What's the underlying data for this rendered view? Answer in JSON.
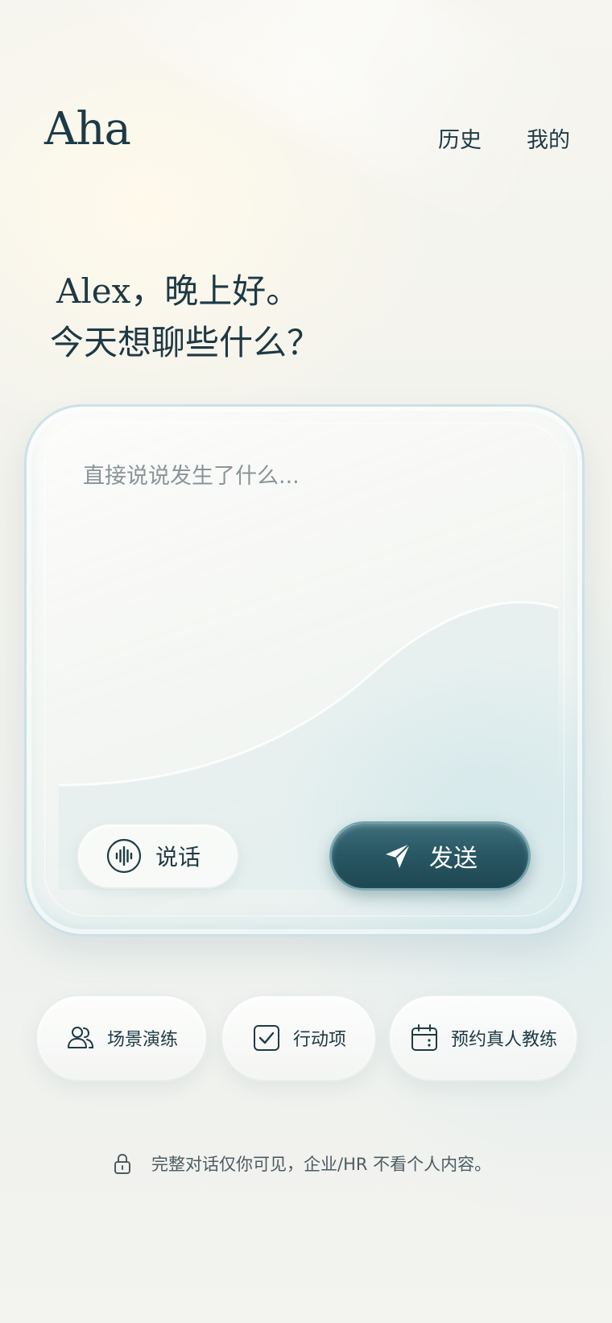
{
  "app": {
    "logo": "Aha"
  },
  "nav": {
    "history": "历史",
    "mine": "我的"
  },
  "greeting": {
    "line1": "Alex，晚上好。",
    "line2": "今天想聊些什么？"
  },
  "composer": {
    "placeholder": "直接说说发生了什么...",
    "speak_label": "说话",
    "send_label": "发送"
  },
  "quick_actions": [
    {
      "label": "场景演练",
      "icon": "users-icon"
    },
    {
      "label": "行动项",
      "icon": "checkbox-icon"
    },
    {
      "label": "预约真人教练",
      "icon": "calendar-icon"
    }
  ],
  "privacy": {
    "text": "完整对话仅你可见，企业/HR 不看个人内容。",
    "icon": "lock-icon"
  },
  "colors": {
    "accent": "#2a5865",
    "text": "#1f3a44",
    "muted": "#8a9498"
  }
}
